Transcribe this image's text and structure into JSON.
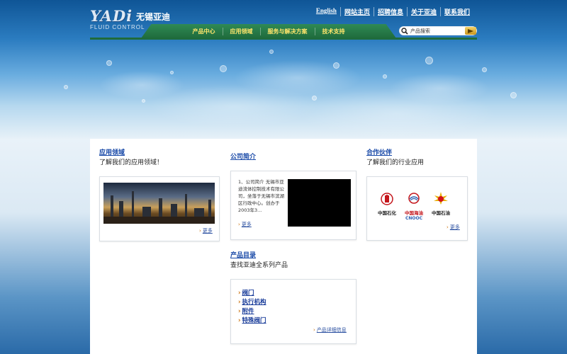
{
  "header": {
    "logo": {
      "wordmark": "YADi",
      "cn_name": "无锡亚迪",
      "subtitle": "FLUID CONTROL"
    },
    "toplinks": [
      "English",
      "网站主页",
      "招聘信息",
      "关于亚迪",
      "联系我们"
    ],
    "nav": [
      "产品中心",
      "应用领域",
      "服务与解决方案",
      "技术支持"
    ],
    "search": {
      "placeholder": "产品搜索",
      "button_icon": "arrow-right-icon"
    }
  },
  "sections": {
    "applications": {
      "title": "应用领域",
      "subtitle": "了解我们的应用领域！",
      "more": "更多"
    },
    "about": {
      "title": "公司简介",
      "text": "1、公司简介 无锡市亚迪流体控制技术有限公司，坐落于无锡市滨湖区行政中心。创办于2003年3...",
      "more": "更多"
    },
    "partners": {
      "title": "合作伙伴",
      "subtitle": "了解我们的行业应用",
      "logos": [
        {
          "name": "中国石化",
          "icon": "sinopec-icon"
        },
        {
          "name": "中国海油",
          "sub": "CNOOC",
          "icon": "cnooc-icon"
        },
        {
          "name": "中国石油",
          "icon": "petrochina-icon"
        }
      ],
      "more": "更多"
    },
    "catalog": {
      "title": "产品目录",
      "subtitle": "查找亚迪全系列产品",
      "items": [
        "阀门",
        "执行机构",
        "附件",
        "特殊阀门"
      ],
      "more": "产品详细信息"
    }
  },
  "colors": {
    "link": "#1a4aa8",
    "nav_bg": "#1f6b3c",
    "nav_text": "#ffe56b",
    "accent_arrow": "#c96b00"
  }
}
